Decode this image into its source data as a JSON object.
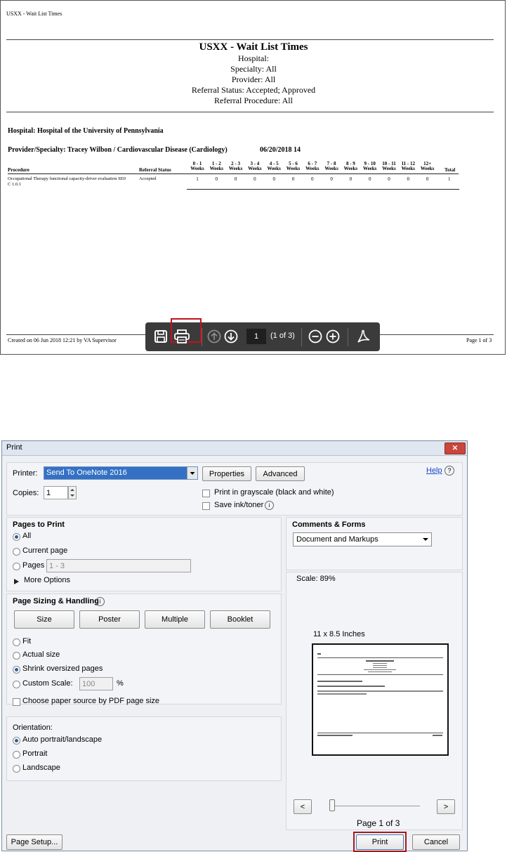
{
  "pdf": {
    "header_left": "USXX - Wait List Times",
    "title": "USXX - Wait List Times",
    "subtitle_lines": [
      "Hospital:",
      "Specialty: All",
      "Provider: All",
      "Referral Status: Accepted; Approved",
      "Referral Procedure: All"
    ],
    "hospital_line": "Hospital: Hospital of the University of Pennsylvania",
    "provider_line": "Provider/Specialty: Tracey Wilbon / Cardiovascular Disease (Cardiology)",
    "date_line": "06/20/2018 14",
    "columns": {
      "procedure": "Procedure",
      "status": "Referral Status",
      "ranges": [
        "0 - 1",
        "1 - 2",
        "2 - 3",
        "3 - 4",
        "4 - 5",
        "5 - 6",
        "6 - 7",
        "7 - 8",
        "8 - 9",
        "9 - 10",
        "10 - 11",
        "11 - 12",
        "12+"
      ],
      "weeks": "Weeks",
      "total": "Total"
    },
    "row": {
      "procedure_line1": "Occupational Therapy functional capacity-driver evaluation SE0",
      "procedure_line2": "C 1.0.1",
      "status": "Accepted",
      "values": [
        "1",
        "0",
        "0",
        "0",
        "0",
        "0",
        "0",
        "0",
        "0",
        "0",
        "0",
        "0",
        "0"
      ],
      "total": "1"
    },
    "footer_left": "Created on 06 Jun 2018 12:21 by VA Supervisor",
    "footer_right": "Page 1 of 3",
    "toolbar": {
      "save_icon": "save-icon",
      "print_icon": "printer-icon",
      "prev_icon": "arrow-up-circle-icon",
      "next_icon": "arrow-down-circle-icon",
      "page_value": "1",
      "page_count": "(1 of 3)",
      "zoom_out_icon": "minus-circle-icon",
      "zoom_in_icon": "plus-circle-icon",
      "acrobat_icon": "acrobat-icon",
      "highlight_color": "#c0131d"
    }
  },
  "dialog": {
    "title": "Print",
    "close_label": "✕",
    "printer_label": "Printer:",
    "printer_value": "Send To OneNote 2016",
    "properties_label": "Properties",
    "advanced_label": "Advanced",
    "help_label": "Help",
    "copies_label": "Copies:",
    "copies_value": "1",
    "grayscale_label": "Print in grayscale (black and white)",
    "save_ink_label": "Save ink/toner",
    "pages_to_print": {
      "heading": "Pages to Print",
      "all": "All",
      "current": "Current page",
      "pages": "Pages",
      "pages_value": "1 - 3",
      "more_options": "More Options"
    },
    "sizing": {
      "heading": "Page Sizing & Handling",
      "size": "Size",
      "poster": "Poster",
      "multiple": "Multiple",
      "booklet": "Booklet",
      "fit": "Fit",
      "actual": "Actual size",
      "shrink": "Shrink oversized pages",
      "custom": "Custom Scale:",
      "custom_value": "100",
      "percent": "%",
      "paper_source": "Choose paper source by PDF page size"
    },
    "orientation": {
      "heading": "Orientation:",
      "auto": "Auto portrait/landscape",
      "portrait": "Portrait",
      "landscape": "Landscape"
    },
    "comments": {
      "heading": "Comments & Forms",
      "value": "Document and Markups"
    },
    "preview": {
      "scale": "Scale:  89%",
      "paper": "11 x 8.5 Inches",
      "page_label": "Page 1 of 3",
      "prev": "<",
      "next": ">"
    },
    "page_setup_label": "Page Setup...",
    "print_label": "Print",
    "cancel_label": "Cancel",
    "accent_color": "#2f5d9a"
  }
}
